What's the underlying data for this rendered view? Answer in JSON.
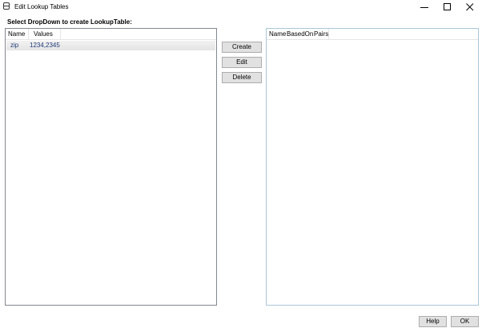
{
  "window": {
    "title": "Edit Lookup Tables",
    "icon": "window-app-icon"
  },
  "instruction": "Select DropDown to create LookupTable:",
  "left_list": {
    "columns": [
      "Name",
      "Values"
    ],
    "rows": [
      {
        "name": "zip",
        "values": "1234,2345"
      }
    ]
  },
  "actions": {
    "create": "Create",
    "edit": "Edit",
    "delete": "Delete"
  },
  "right_list": {
    "columns": [
      "Name",
      "BasedOn",
      "Pairs"
    ]
  },
  "footer": {
    "help": "Help",
    "ok": "OK"
  },
  "colors": {
    "selected_row": "#e8e8e8",
    "cell_text": "#1f3a78",
    "border": "#828790"
  }
}
